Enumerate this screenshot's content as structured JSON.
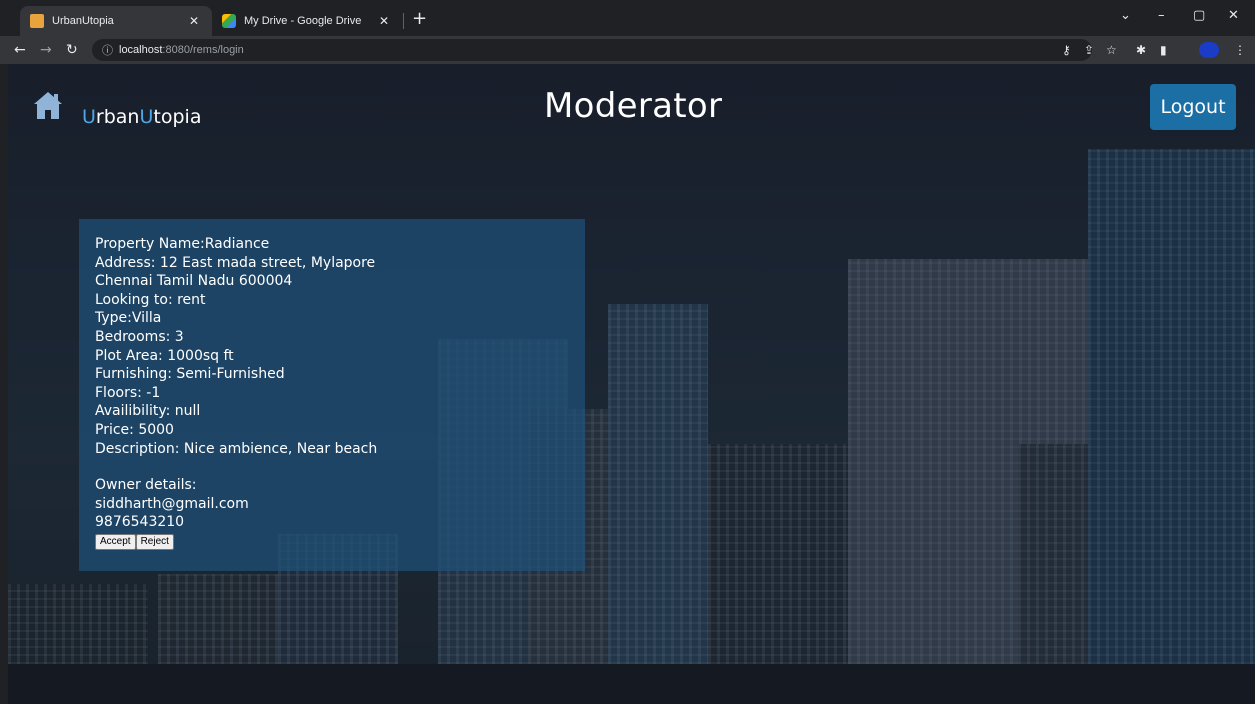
{
  "browser": {
    "tabs": [
      {
        "title": "UrbanUtopia",
        "active": true,
        "favicon_color": "#e8a33d"
      },
      {
        "title": "My Drive - Google Drive",
        "active": false,
        "favicon_color": "#34a853"
      }
    ],
    "new_tab_icon": "+",
    "url_host": "localhost",
    "url_path": ":8080/rems/login",
    "window_controls": {
      "minimize": "–",
      "maximize": "▢",
      "close": "✕",
      "dropdown": "⌄"
    }
  },
  "app": {
    "brand_prefix": "U",
    "brand_mid": "rban",
    "brand_accent2": "U",
    "brand_suffix": "topia",
    "page_title": "Moderator",
    "logout_label": "Logout",
    "accent_color": "#4aa8e8",
    "button_color": "#1b6fa5"
  },
  "property": {
    "name_line": "Property Name:Radiance",
    "address_line1": "Address: 12 East mada street, Mylapore",
    "address_line2": "Chennai Tamil Nadu 600004",
    "looking_to": "Looking to: rent",
    "type": "Type:Villa",
    "bedrooms": "Bedrooms: 3",
    "plot_area": "Plot Area: 1000sq ft",
    "furnishing": "Furnishing: Semi-Furnished",
    "floors": "Floors: -1",
    "availability": "Availibility: null",
    "price": "Price: 5000",
    "description": "Description: Nice ambience, Near beach",
    "owner_heading": "Owner details:",
    "owner_email": "siddharth@gmail.com",
    "owner_phone": "9876543210",
    "accept_label": "Accept",
    "reject_label": "Reject"
  }
}
